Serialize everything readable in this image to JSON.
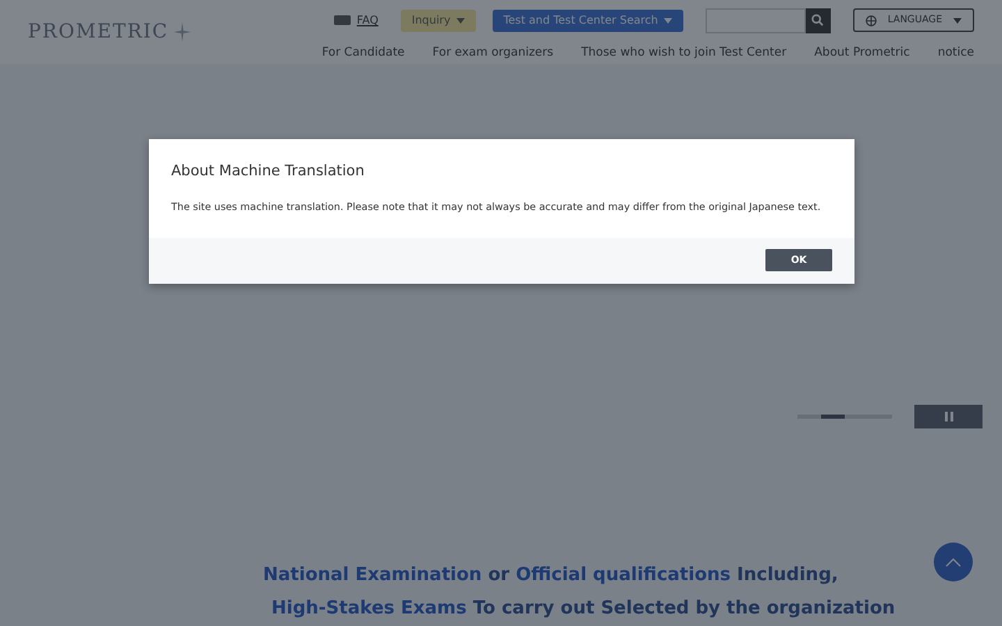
{
  "header": {
    "logo": "PROMETRIC",
    "utility": [
      {
        "kind": "link",
        "label": "FAQ"
      },
      {
        "kind": "inquiry",
        "label": "Inquiry"
      },
      {
        "kind": "search-menu",
        "label": "Test and Test Center Search"
      },
      {
        "kind": "search"
      },
      {
        "kind": "language",
        "label": "LANGUAGE"
      }
    ],
    "nav": [
      "For Candidate",
      "For exam organizers",
      "Those who wish to join Test Center",
      "About Prometric",
      "notice"
    ]
  },
  "carousel": {
    "indicators": [
      {
        "selected": false
      },
      {
        "selected": true
      },
      {
        "selected": false
      },
      {
        "selected": false
      }
    ]
  },
  "headline": [
    "**National Examination** or **Official qualifications** Including,",
    "**High-Stakes Exams** To carry out Selected by the organization"
  ],
  "modal": {
    "title": "About Machine Translation",
    "body": "The site uses machine translation. Please note that it may not always be accurate and may differ from the original Japanese text.",
    "button": "OK"
  }
}
